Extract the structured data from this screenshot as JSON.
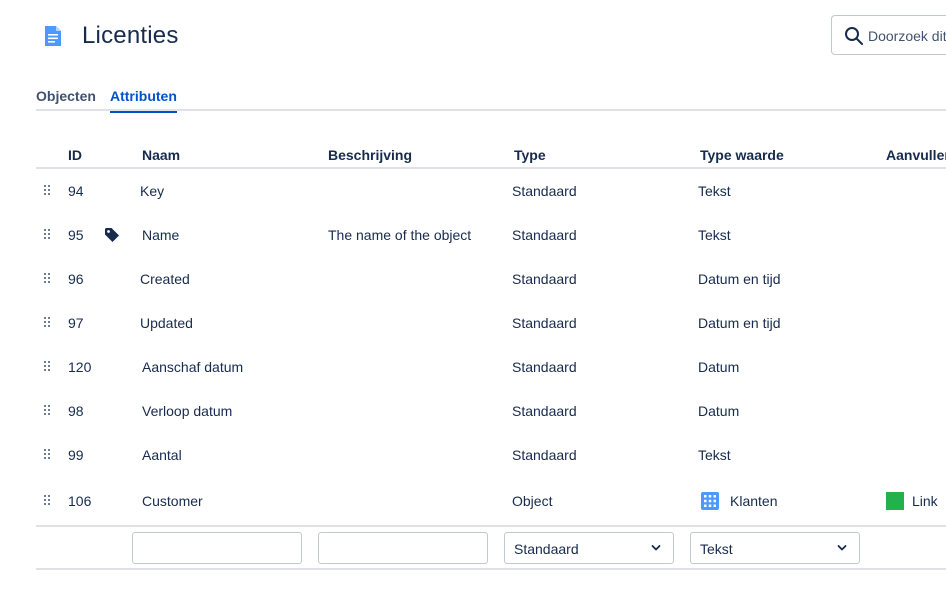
{
  "header": {
    "title": "Licenties",
    "search_placeholder": "Doorzoek dit"
  },
  "tabs": [
    {
      "label": "Objecten",
      "active": false
    },
    {
      "label": "Attributen",
      "active": true
    }
  ],
  "table": {
    "columns": [
      "ID",
      "Naam",
      "Beschrijving",
      "Type",
      "Type waarde",
      "Aanvullend"
    ],
    "rows": [
      {
        "id": "94",
        "name": "Key",
        "description": "",
        "type": "Standaard",
        "type_value": "Tekst",
        "extra": ""
      },
      {
        "id": "95",
        "name": "Name",
        "description": "The name of the object",
        "type": "Standaard",
        "type_value": "Tekst",
        "extra": "",
        "label_icon": "tag-icon"
      },
      {
        "id": "96",
        "name": "Created",
        "description": "",
        "type": "Standaard",
        "type_value": "Datum en tijd",
        "extra": ""
      },
      {
        "id": "97",
        "name": "Updated",
        "description": "",
        "type": "Standaard",
        "type_value": "Datum en tijd",
        "extra": ""
      },
      {
        "id": "120",
        "name": "Aanschaf datum",
        "description": "",
        "type": "Standaard",
        "type_value": "Datum",
        "extra": ""
      },
      {
        "id": "98",
        "name": "Verloop datum",
        "description": "",
        "type": "Standaard",
        "type_value": "Datum",
        "extra": ""
      },
      {
        "id": "99",
        "name": "Aantal",
        "description": "",
        "type": "Standaard",
        "type_value": "Tekst",
        "extra": ""
      },
      {
        "id": "106",
        "name": "Customer",
        "description": "",
        "type": "Object",
        "type_value": "Klanten",
        "type_value_icon": "building-grid-icon",
        "extra": "Link",
        "extra_color": "#22b14c"
      }
    ]
  },
  "new_attribute": {
    "name_value": "",
    "description_value": "",
    "type_selected": "Standaard",
    "type_value_selected": "Tekst"
  },
  "colors": {
    "accent": "#0052cc",
    "text": "#172b4d",
    "border": "#dfe1e6",
    "link_swatch": "#22b14c"
  }
}
